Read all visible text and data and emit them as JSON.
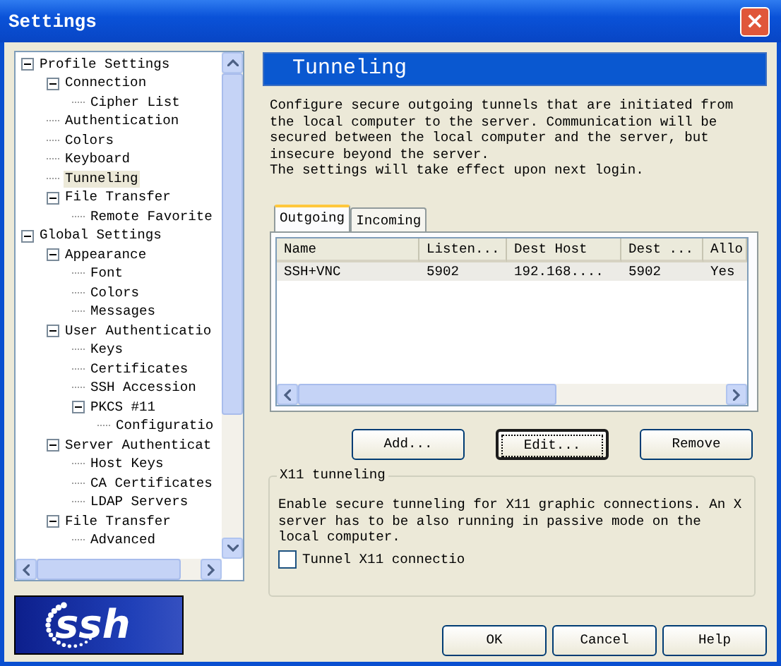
{
  "window": {
    "title": "Settings",
    "close": "×"
  },
  "tree": {
    "items": [
      {
        "label": "Profile Settings",
        "expanded": true,
        "selected": false,
        "children": [
          {
            "label": "Connection",
            "expanded": true,
            "selected": false,
            "children": [
              {
                "label": "Cipher List",
                "selected": false
              }
            ]
          },
          {
            "label": "Authentication",
            "selected": false
          },
          {
            "label": "Colors",
            "selected": false
          },
          {
            "label": "Keyboard",
            "selected": false
          },
          {
            "label": "Tunneling",
            "selected": true
          },
          {
            "label": "File Transfer",
            "expanded": true,
            "selected": false,
            "children": [
              {
                "label": "Remote Favorite",
                "selected": false
              }
            ]
          }
        ]
      },
      {
        "label": "Global Settings",
        "expanded": true,
        "selected": false,
        "children": [
          {
            "label": "Appearance",
            "expanded": true,
            "selected": false,
            "children": [
              {
                "label": "Font",
                "selected": false
              },
              {
                "label": "Colors",
                "selected": false
              },
              {
                "label": "Messages",
                "selected": false
              }
            ]
          },
          {
            "label": "User Authenticatio",
            "expanded": true,
            "selected": false,
            "children": [
              {
                "label": "Keys",
                "selected": false
              },
              {
                "label": "Certificates",
                "selected": false
              },
              {
                "label": "SSH Accession",
                "selected": false
              },
              {
                "label": "PKCS #11",
                "expanded": true,
                "selected": false,
                "children": [
                  {
                    "label": "Configuratio",
                    "selected": false
                  }
                ]
              }
            ]
          },
          {
            "label": "Server Authenticat",
            "expanded": true,
            "selected": false,
            "children": [
              {
                "label": "Host Keys",
                "selected": false
              },
              {
                "label": "CA Certificates",
                "selected": false
              },
              {
                "label": "LDAP Servers",
                "selected": false
              }
            ]
          },
          {
            "label": "File Transfer",
            "expanded": true,
            "selected": false,
            "children": [
              {
                "label": "Advanced",
                "selected": false
              }
            ]
          }
        ]
      }
    ]
  },
  "logo": {
    "text": "ssh"
  },
  "panel": {
    "title": "Tunneling",
    "description": [
      "Configure secure outgoing tunnels that are initiated from",
      "the local computer to the server. Communication will be",
      "secured between the local computer and the server, but",
      "insecure beyond the server.",
      "The settings will take effect upon next login."
    ],
    "tabs": [
      {
        "label": "Outgoing",
        "selected": true
      },
      {
        "label": "Incoming",
        "selected": false
      }
    ],
    "table": {
      "columns": [
        "Name",
        "Listen...",
        "Dest Host",
        "Dest ...",
        "Allo"
      ],
      "rows": [
        {
          "cells": [
            "SSH+VNC",
            "5902",
            "192.168....",
            "5902",
            "Yes"
          ],
          "selected": false
        }
      ]
    },
    "buttons": [
      {
        "label": "Add...",
        "focused": false
      },
      {
        "label": "Edit...",
        "focused": true
      },
      {
        "label": "Remove",
        "focused": false
      }
    ],
    "x11": {
      "title": "X11 tunneling",
      "text": "Enable secure tunneling for X11 graphic connections. An X server has to be also running in passive mode on the local computer.",
      "checkbox": {
        "label": "Tunnel X11 connectio",
        "checked": false
      }
    }
  },
  "footer_buttons": [
    "OK",
    "Cancel",
    "Help"
  ]
}
